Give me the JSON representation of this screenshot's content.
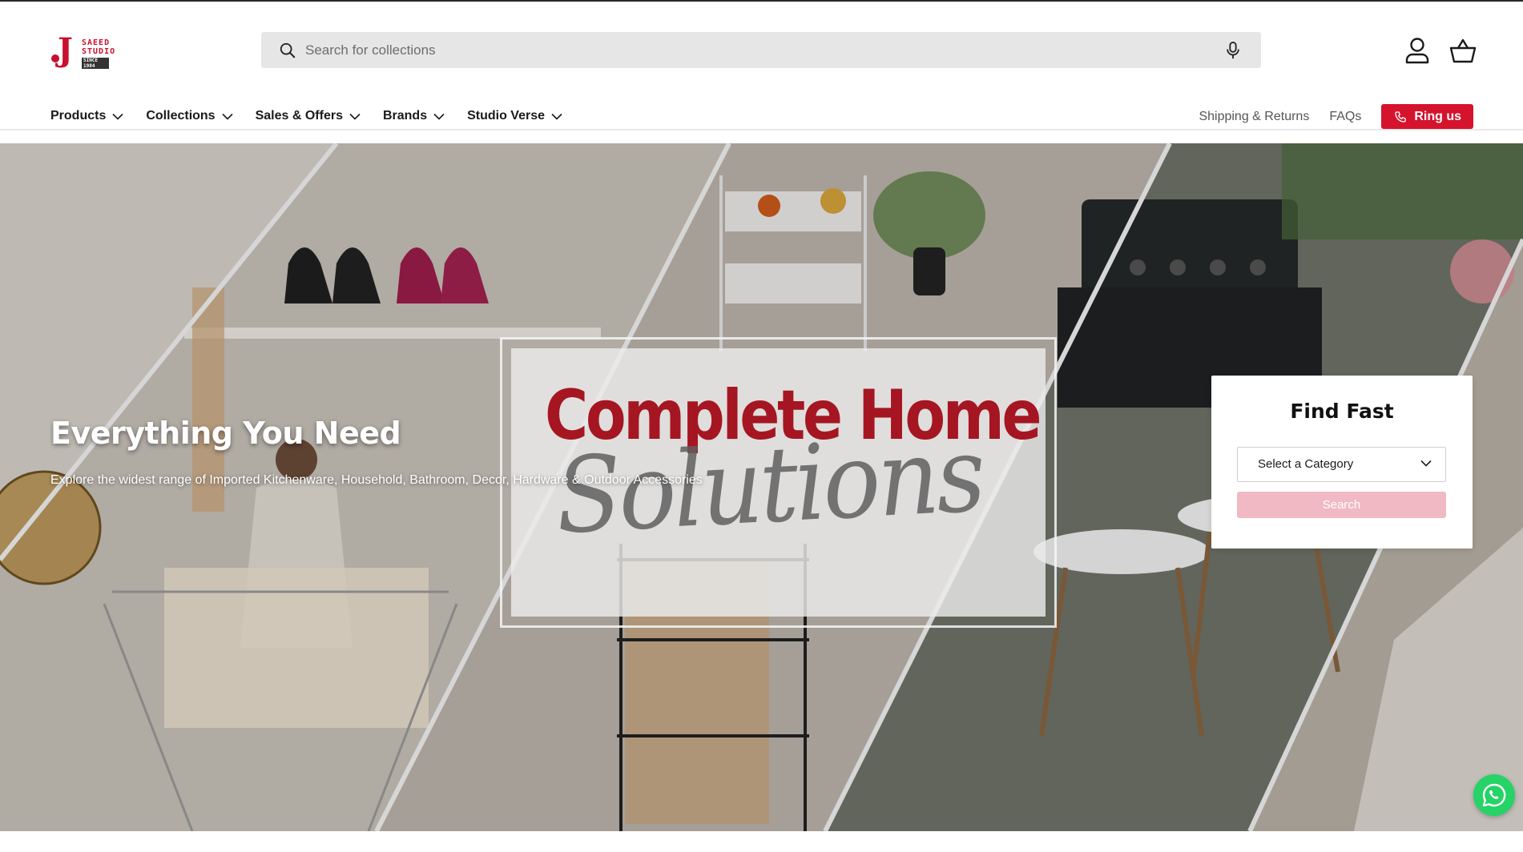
{
  "brand": {
    "logo_text_line1": "SAEED",
    "logo_text_line2": "STUDIO",
    "logo_text_small": "SINCE 1984",
    "accent_color": "#d5132d"
  },
  "search": {
    "placeholder": "Search for collections",
    "icon": "search-icon",
    "voice_icon": "microphone-icon"
  },
  "header_icons": {
    "account": "account-icon",
    "cart": "basket-icon"
  },
  "nav": {
    "items": [
      {
        "label": "Products"
      },
      {
        "label": "Collections"
      },
      {
        "label": "Sales & Offers"
      },
      {
        "label": "Brands"
      },
      {
        "label": "Studio Verse"
      }
    ],
    "right_links": [
      {
        "label": "Shipping & Returns"
      },
      {
        "label": "FAQs"
      }
    ],
    "ring_button": "Ring us"
  },
  "hero": {
    "headline": "Everything You Need",
    "subtext": "Explore the widest range of Imported Kitchenware, Household, Bathroom, Decor, Hardware & Outdoor Accessories",
    "banner_line1": "Complete Home",
    "banner_line2": "Solutions"
  },
  "find_fast": {
    "title": "Find Fast",
    "select_value": "Select a Category",
    "button_label": "Search",
    "button_color": "#f1b9c3"
  },
  "floating": {
    "whatsapp_icon": "whatsapp-icon",
    "whatsapp_color": "#25d366"
  }
}
